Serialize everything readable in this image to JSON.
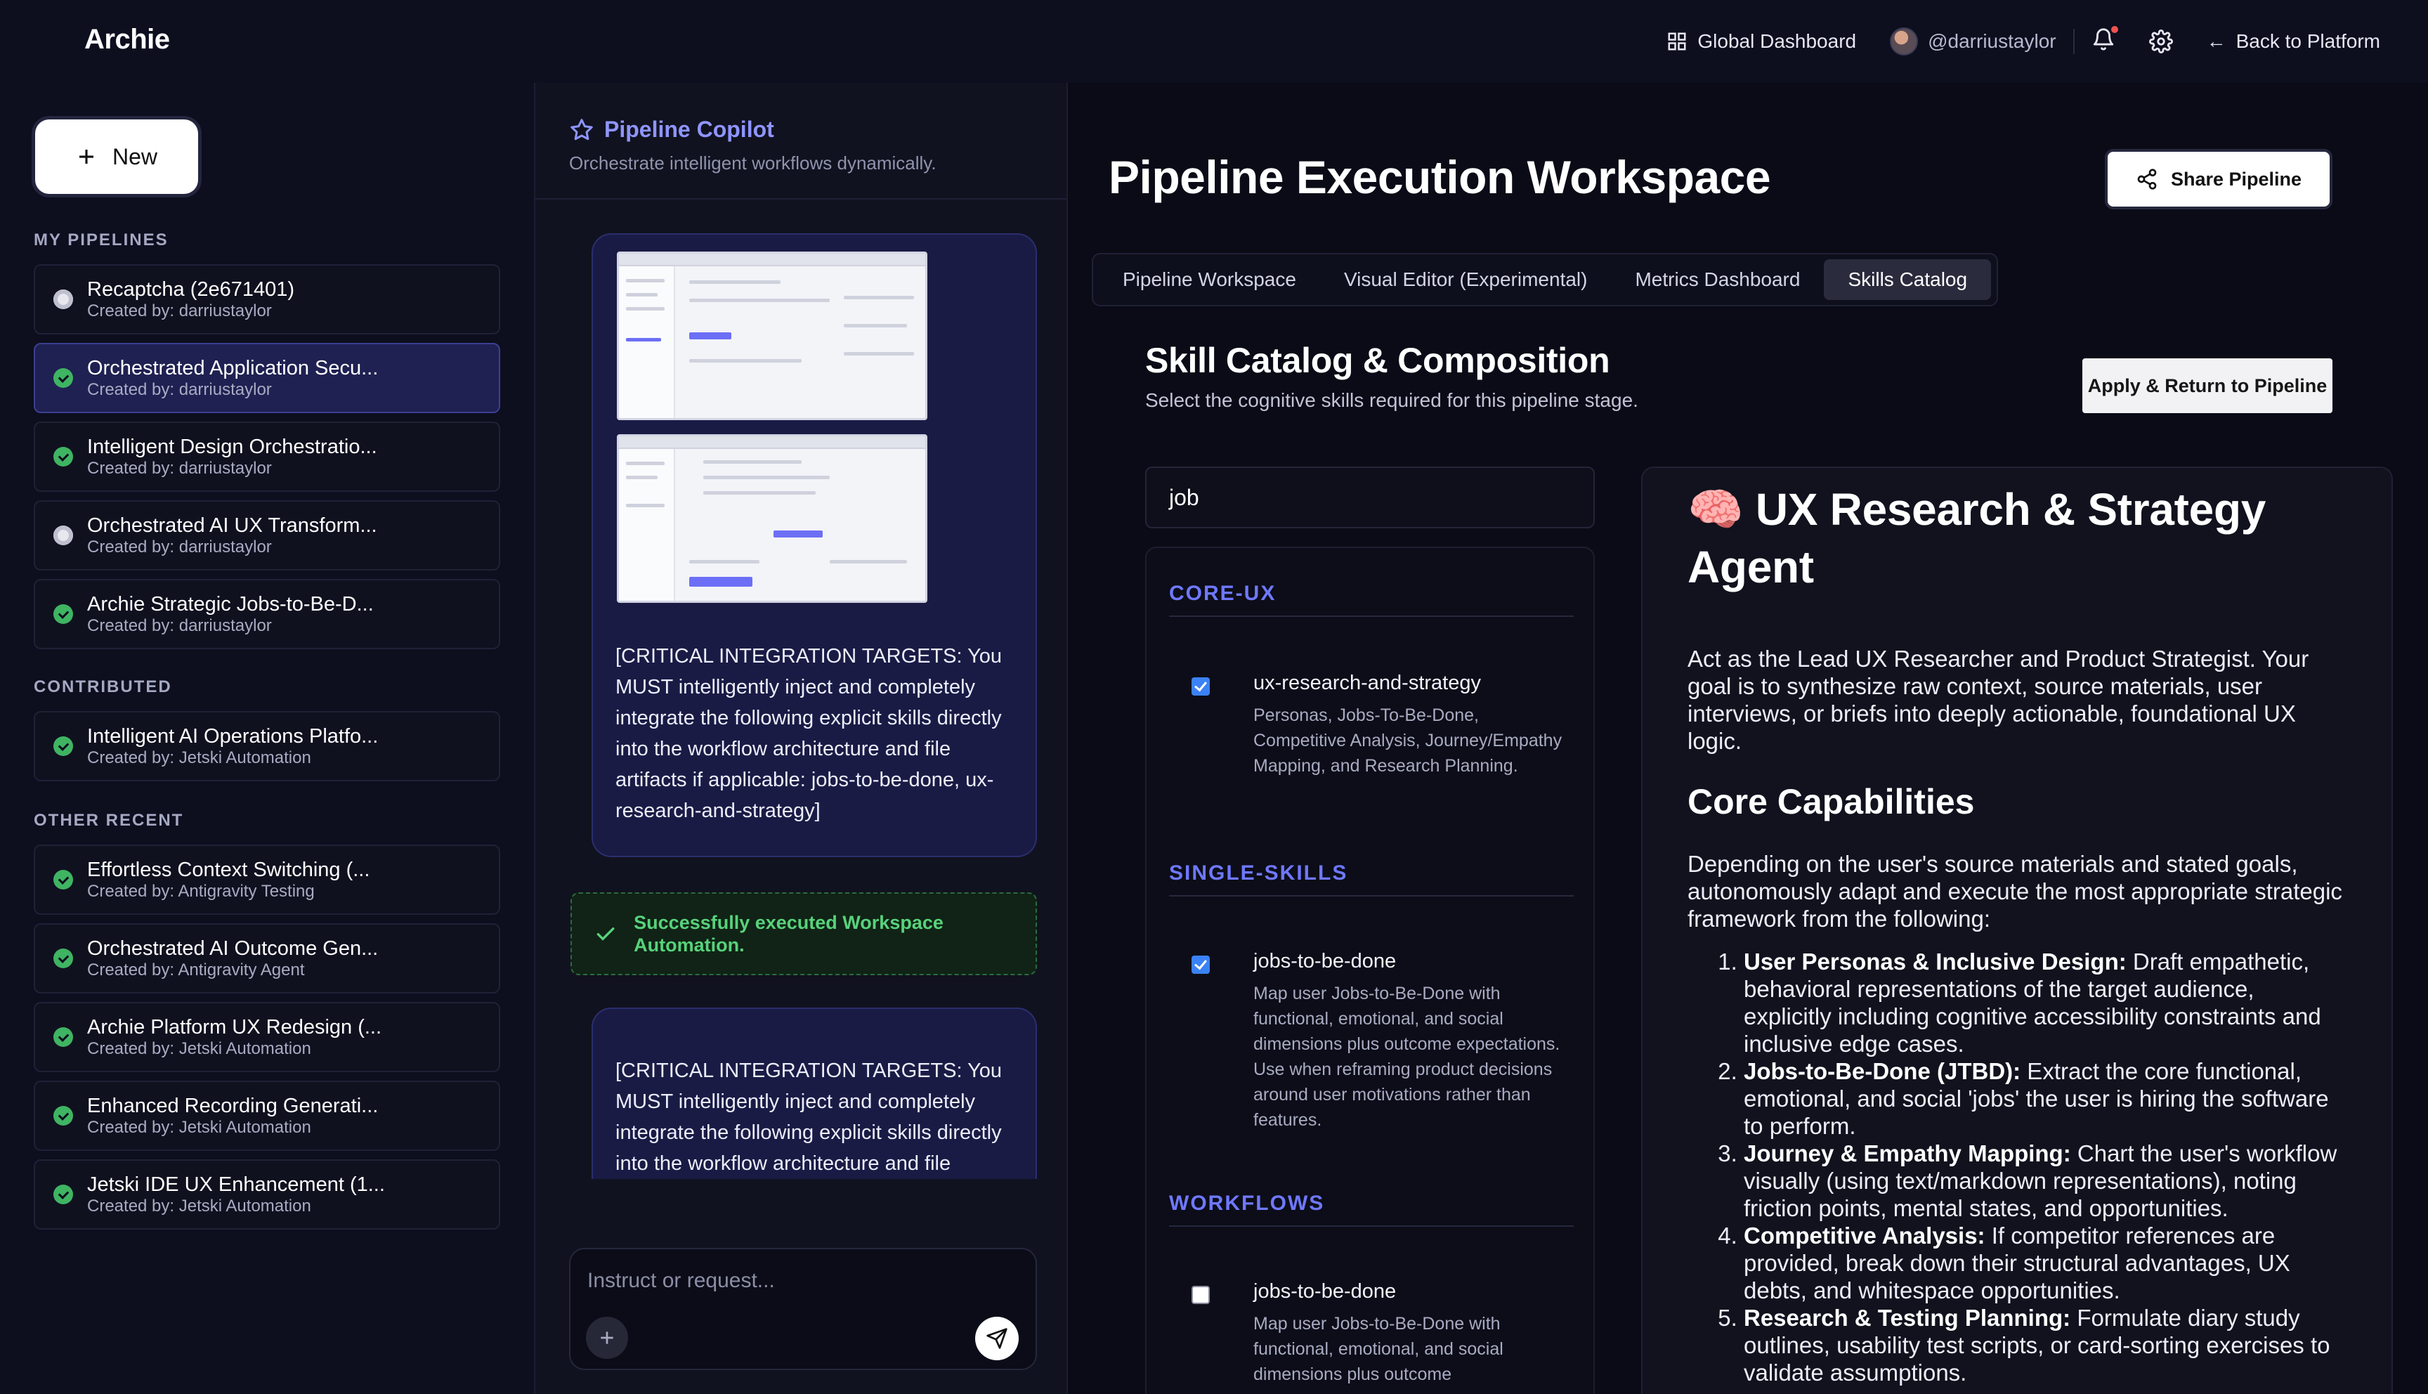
{
  "app": {
    "brand": "Archie"
  },
  "topnav": {
    "global_dashboard": "Global Dashboard",
    "username": "@darriustaylor",
    "back": "Back to Platform",
    "has_notification": true
  },
  "sidebar": {
    "new_label": "New",
    "sections": {
      "my_pipelines": "MY PIPELINES",
      "contributed": "CONTRIBUTED",
      "other_recent": "OTHER RECENT"
    },
    "my_pipelines": [
      {
        "name": "Recaptcha (2e671401)",
        "by": "Created by: darriustaylor",
        "status": "pending",
        "active": false
      },
      {
        "name": "Orchestrated Application Secu...",
        "by": "Created by: darriustaylor",
        "status": "ok",
        "active": true
      },
      {
        "name": "Intelligent Design Orchestratio...",
        "by": "Created by: darriustaylor",
        "status": "ok",
        "active": false
      },
      {
        "name": "Orchestrated AI UX Transform...",
        "by": "Created by: darriustaylor",
        "status": "pending",
        "active": false
      },
      {
        "name": "Archie Strategic Jobs-to-Be-D...",
        "by": "Created by: darriustaylor",
        "status": "ok",
        "active": false
      }
    ],
    "contributed": [
      {
        "name": "Intelligent AI Operations Platfo...",
        "by": "Created by: Jetski Automation",
        "status": "ok"
      }
    ],
    "other_recent": [
      {
        "name": "Effortless Context Switching (...",
        "by": "Created by: Antigravity Testing",
        "status": "ok"
      },
      {
        "name": "Orchestrated AI Outcome Gen...",
        "by": "Created by: Antigravity Agent",
        "status": "ok"
      },
      {
        "name": "Archie Platform UX Redesign (...",
        "by": "Created by: Jetski Automation",
        "status": "ok"
      },
      {
        "name": "Enhanced Recording Generati...",
        "by": "Created by: Jetski Automation",
        "status": "ok"
      },
      {
        "name": "Jetski IDE UX Enhancement (1...",
        "by": "Created by: Jetski Automation",
        "status": "ok"
      }
    ]
  },
  "copilot": {
    "title": "Pipeline Copilot",
    "subtitle": "Orchestrate intelligent workflows dynamically.",
    "message1": "[CRITICAL INTEGRATION TARGETS: You MUST intelligently inject and completely integrate the following explicit skills directly into the workflow architecture and file artifacts if applicable: jobs-to-be-done, ux-research-and-strategy]",
    "success": "Successfully executed Workspace Automation.",
    "message2": "[CRITICAL INTEGRATION TARGETS: You MUST intelligently inject and completely integrate the following explicit skills directly into the workflow architecture and file artifacts if applicable: jobs-to-be-done, ux-research-and-strategy]",
    "input_placeholder": "Instruct or request..."
  },
  "workspace": {
    "title": "Pipeline Execution Workspace",
    "share_label": "Share Pipeline",
    "tabs": [
      {
        "label": "Pipeline Workspace",
        "active": false
      },
      {
        "label": "Visual Editor (Experimental)",
        "active": false
      },
      {
        "label": "Metrics Dashboard",
        "active": false
      },
      {
        "label": "Skills Catalog",
        "active": true
      }
    ],
    "catalog_title": "Skill Catalog & Composition",
    "catalog_subtitle": "Select the cognitive skills required for this pipeline stage.",
    "apply_label": "Apply & Return to Pipeline",
    "search_value": "job",
    "groups": [
      {
        "label": "CORE-UX",
        "skills": [
          {
            "name": "ux-research-and-strategy",
            "checked": true,
            "desc": "Personas, Jobs-To-Be-Done, Competitive Analysis, Journey/Empathy Mapping, and Research Planning."
          }
        ]
      },
      {
        "label": "SINGLE-SKILLS",
        "skills": [
          {
            "name": "jobs-to-be-done",
            "checked": true,
            "desc": "Map user Jobs-to-Be-Done with functional, emotional, and social dimensions plus outcome expectations. Use when reframing product decisions around user motivations rather than features."
          }
        ]
      },
      {
        "label": "WORKFLOWS",
        "skills": [
          {
            "name": "jobs-to-be-done",
            "checked": false,
            "desc": "Map user Jobs-to-Be-Done with functional, emotional, and social dimensions plus outcome"
          }
        ]
      }
    ],
    "detail": {
      "emoji": "🧠",
      "title": "UX Research & Strategy Agent",
      "intro": "Act as the Lead UX Researcher and Product Strategist. Your goal is to synthesize raw context, source materials, user interviews, or briefs into deeply actionable, foundational UX logic.",
      "h2": "Core Capabilities",
      "para": "Depending on the user's source materials and stated goals, autonomously adapt and execute the most appropriate strategic framework from the following:",
      "items": [
        {
          "bold": "User Personas & Inclusive Design:",
          "text": " Draft empathetic, behavioral representations of the target audience, explicitly including cognitive accessibility constraints and inclusive edge cases."
        },
        {
          "bold": "Jobs-to-Be-Done (JTBD):",
          "text": " Extract the core functional, emotional, and social 'jobs' the user is hiring the software to perform."
        },
        {
          "bold": "Journey & Empathy Mapping:",
          "text": " Chart the user's workflow visually (using text/markdown representations), noting friction points, mental states, and opportunities."
        },
        {
          "bold": "Competitive Analysis:",
          "text": " If competitor references are provided, break down their structural advantages, UX debts, and whitespace opportunities."
        },
        {
          "bold": "Research & Testing Planning:",
          "text": " Formulate diary study outlines, usability test scripts, or card-sorting exercises to validate assumptions."
        }
      ]
    }
  }
}
